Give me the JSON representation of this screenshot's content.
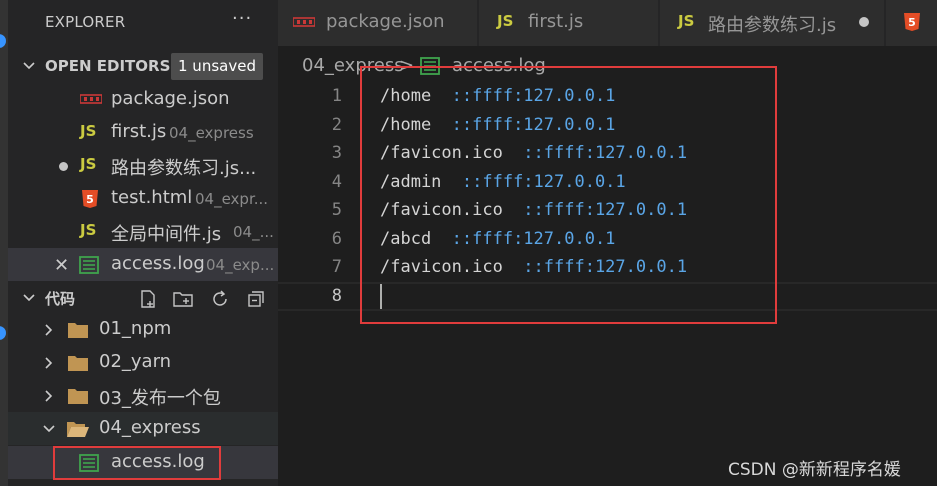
{
  "explorer": {
    "title": "EXPLORER",
    "more": "···"
  },
  "open_editors": {
    "label": "OPEN EDITORS",
    "badge": "1 unsaved",
    "items": [
      {
        "name": "package.json",
        "desc": ""
      },
      {
        "name": "first.js",
        "desc": "04_express"
      },
      {
        "name": "路由参数练习.js...",
        "desc": ""
      },
      {
        "name": "test.html",
        "desc": "04_expr..."
      },
      {
        "name": "全局中间件.js",
        "desc": "04_..."
      },
      {
        "name": "access.log",
        "desc": "04_exp..."
      }
    ]
  },
  "workspace": {
    "label": "代码",
    "folders": [
      {
        "name": "01_npm"
      },
      {
        "name": "02_yarn"
      },
      {
        "name": "03_发布一个包"
      },
      {
        "name": "04_express"
      }
    ],
    "file": "access.log"
  },
  "tabs": [
    {
      "label": "package.json"
    },
    {
      "label": "first.js"
    },
    {
      "label": "路由参数练习.js"
    }
  ],
  "breadcrumb": {
    "folder": "04_express",
    "separator": ">",
    "file": "access.log"
  },
  "editor": {
    "lines": [
      {
        "num": "1",
        "path": "/home  ",
        "addr": "::ffff:127.0.0.1"
      },
      {
        "num": "2",
        "path": "/home  ",
        "addr": "::ffff:127.0.0.1"
      },
      {
        "num": "3",
        "path": "/favicon.ico  ",
        "addr": "::ffff:127.0.0.1"
      },
      {
        "num": "4",
        "path": "/admin  ",
        "addr": "::ffff:127.0.0.1"
      },
      {
        "num": "5",
        "path": "/favicon.ico  ",
        "addr": "::ffff:127.0.0.1"
      },
      {
        "num": "6",
        "path": "/abcd  ",
        "addr": "::ffff:127.0.0.1"
      },
      {
        "num": "7",
        "path": "/favicon.ico  ",
        "addr": "::ffff:127.0.0.1"
      },
      {
        "num": "8",
        "path": "",
        "addr": ""
      }
    ]
  },
  "watermark": "CSDN @新新程序名媛",
  "colors": {
    "accent": "#3794ff",
    "js": "#cbcb41",
    "html": "#e44d26",
    "log": "#3fa34d",
    "folder": "#c09553",
    "highlight_box": "#e03c3c",
    "address": "#5aa5e6"
  }
}
